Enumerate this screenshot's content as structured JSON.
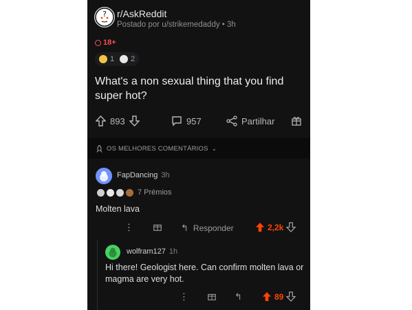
{
  "post": {
    "subreddit": "r/AskReddit",
    "posted_by": "Postado por u/strikemedaddy",
    "age": "3h",
    "nsfw_label": "18+",
    "awards": [
      {
        "count": "1"
      },
      {
        "count": "2"
      }
    ],
    "title": "What's a non sexual thing that you find super hot?",
    "upvotes": "893",
    "comments": "957",
    "share_label": "Partilhar"
  },
  "sort": {
    "label": "OS MELHORES COMENTÁRIOS"
  },
  "comment1": {
    "user": "FapDancing",
    "age": "3h",
    "awards_label": "7 Prémios",
    "body": "Molten lava",
    "reply_label": "Responder",
    "score": "2,2k",
    "colors": {
      "avatar": "#7193ff",
      "upvote": "#ff4500"
    }
  },
  "comment2": {
    "user": "wolfram127",
    "age": "1h",
    "body": "Hi there! Geologist here. Can confirm molten lava or magma are very hot.",
    "score": "89",
    "colors": {
      "avatar": "#46d160",
      "upvote": "#ff4500"
    }
  }
}
